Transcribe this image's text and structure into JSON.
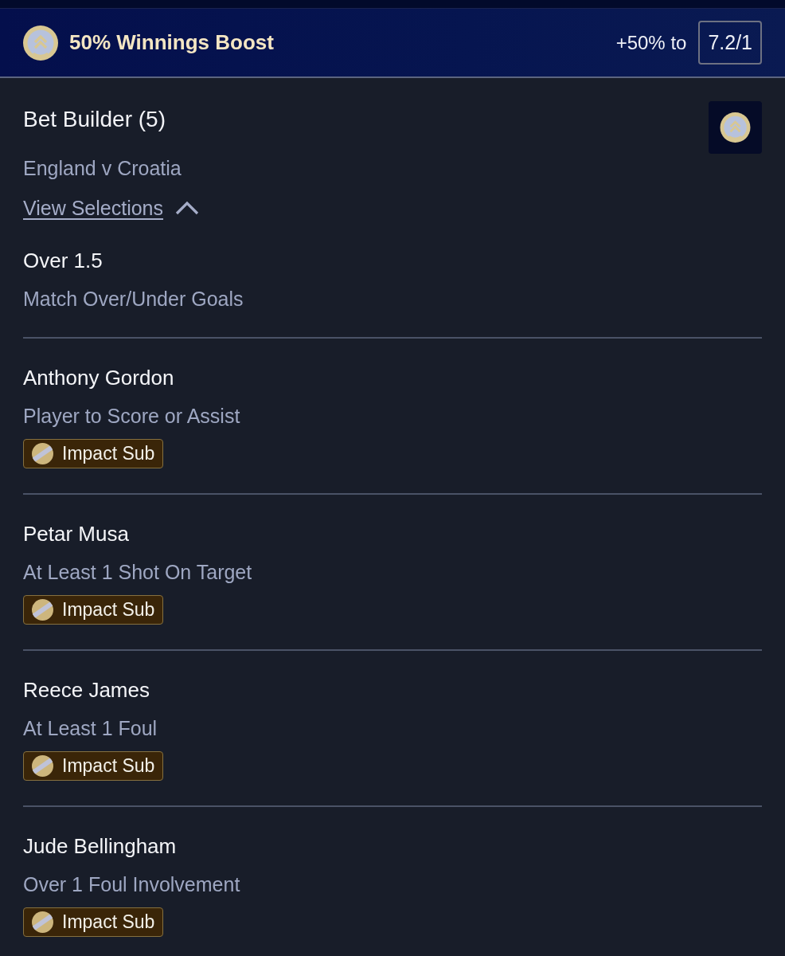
{
  "boost_banner": {
    "title": "50% Winnings Boost",
    "boost_text": "+50% to",
    "odds": "7.2/1"
  },
  "bet": {
    "title": "Bet Builder (5)",
    "event": "England v Croatia",
    "view_link": {
      "label": "View Selections",
      "expanded": true
    },
    "selections": [
      {
        "name": "Over 1.5",
        "market": "Match Over/Under Goals"
      },
      {
        "name": "Anthony Gordon",
        "market": "Player to Score or Assist",
        "tag": "Impact Sub"
      },
      {
        "name": "Petar Musa",
        "market": "At Least 1 Shot On Target",
        "tag": "Impact Sub"
      },
      {
        "name": "Reece James",
        "market": "At Least 1 Foul",
        "tag": "Impact Sub"
      },
      {
        "name": "Jude Bellingham",
        "market": "Over 1 Foul Involvement",
        "tag": "Impact Sub"
      }
    ]
  }
}
